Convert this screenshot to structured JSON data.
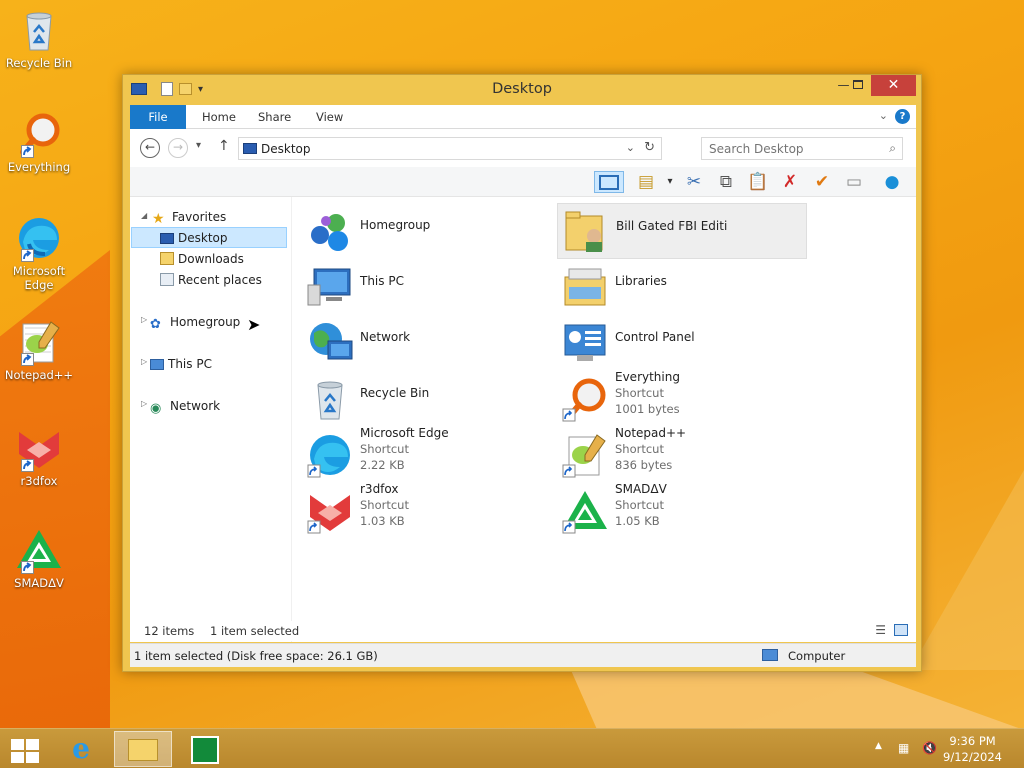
{
  "desktop": {
    "icons": [
      {
        "label": "Recycle Bin"
      },
      {
        "label": "Everything"
      },
      {
        "label": "Microsoft Edge"
      },
      {
        "label": "Notepad++"
      },
      {
        "label": "r3dfox"
      },
      {
        "label": "SMADΔV"
      }
    ]
  },
  "window": {
    "title": "Desktop",
    "ribbon_tabs": [
      "File",
      "Home",
      "Share",
      "View"
    ],
    "address": "Desktop",
    "search_placeholder": "Search Desktop",
    "nav": {
      "favorites": "Favorites",
      "desktop": "Desktop",
      "downloads": "Downloads",
      "recent": "Recent places",
      "homegroup": "Homegroup",
      "thispc": "This PC",
      "network": "Network"
    },
    "items": [
      {
        "name": "Homegroup"
      },
      {
        "name": "Bill Gated FBI Editi"
      },
      {
        "name": "This PC"
      },
      {
        "name": "Libraries"
      },
      {
        "name": "Network"
      },
      {
        "name": "Control Panel"
      },
      {
        "name": "Recycle Bin"
      },
      {
        "name": "Everything",
        "type": "Shortcut",
        "size": "1001 bytes"
      },
      {
        "name": "Microsoft Edge",
        "type": "Shortcut",
        "size": "2.22 KB"
      },
      {
        "name": "Notepad++",
        "type": "Shortcut",
        "size": "836 bytes"
      },
      {
        "name": "r3dfox",
        "type": "Shortcut",
        "size": "1.03 KB"
      },
      {
        "name": "SMADΔV",
        "type": "Shortcut",
        "size": "1.05 KB"
      }
    ],
    "status": {
      "count": "12 items",
      "selected": "1 item selected",
      "details": "1 item selected (Disk free space: 26.1 GB)",
      "location": "Computer"
    }
  },
  "taskbar": {
    "time": "9:36 PM",
    "date": "9/12/2024"
  },
  "colors": {
    "accent": "#1979ca",
    "close": "#c7413b",
    "selection": "#cce8ff"
  }
}
